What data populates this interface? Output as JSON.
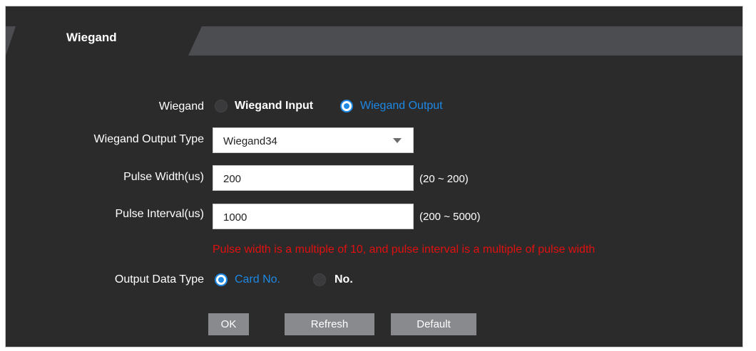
{
  "tab": {
    "label": "Wiegand"
  },
  "wiegand": {
    "label": "Wiegand",
    "options": [
      {
        "label": "Wiegand Input",
        "selected": false
      },
      {
        "label": "Wiegand Output",
        "selected": true
      }
    ]
  },
  "output_type": {
    "label": "Wiegand Output Type",
    "value": "Wiegand34",
    "icon": "chevron-down-icon"
  },
  "pulse_width": {
    "label": "Pulse Width(us)",
    "value": "200",
    "range": "(20 ~ 200)"
  },
  "pulse_interval": {
    "label": "Pulse Interval(us)",
    "value": "1000",
    "range": "(200 ~ 5000)"
  },
  "warning": "Pulse width is a multiple of 10, and pulse interval is a multiple of pulse width",
  "output_data_type": {
    "label": "Output Data Type",
    "options": [
      {
        "label": "Card No.",
        "selected": true
      },
      {
        "label": "No.",
        "selected": false
      }
    ]
  },
  "buttons": {
    "ok": "OK",
    "refresh": "Refresh",
    "default": "Default"
  },
  "colors": {
    "background": "#2b2b2b",
    "tab_strip": "#4c4d51",
    "accent": "#1e88e5",
    "warning": "#e01010",
    "button": "#888a8e"
  }
}
